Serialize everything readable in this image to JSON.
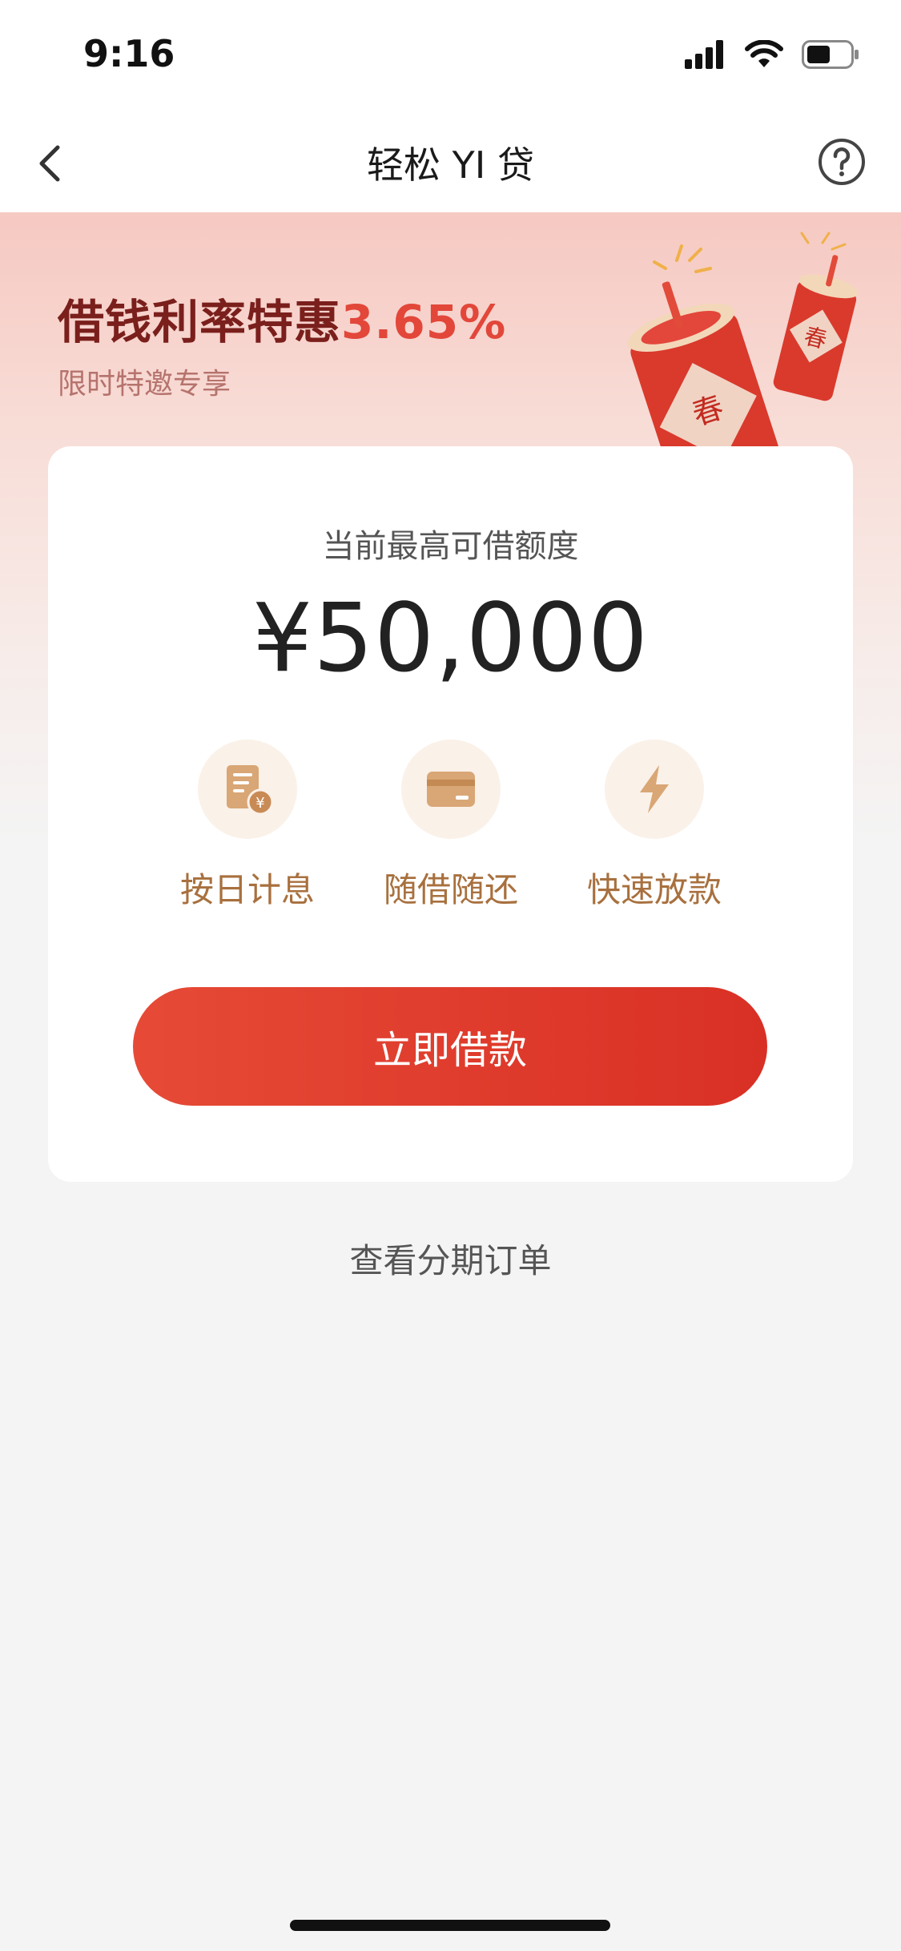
{
  "status_bar": {
    "time": "9:16",
    "battery_level": 0.55
  },
  "nav": {
    "title": "轻松 YI 贷",
    "back_icon": "chevron-left-icon",
    "help_icon": "question-circle-icon"
  },
  "promo": {
    "title_text": "借钱利率特惠",
    "rate": "3.65%",
    "subtitle": "限时特邀专享",
    "decoration_text": "春"
  },
  "card": {
    "limit_label": "当前最高可借额度",
    "limit_amount": "¥50,000",
    "features": [
      {
        "label": "按日计息",
        "icon": "receipt-yen-icon"
      },
      {
        "label": "随借随还",
        "icon": "card-icon"
      },
      {
        "label": "快速放款",
        "icon": "lightning-icon"
      }
    ],
    "borrow_button": "立即借款"
  },
  "orders_link": "查看分期订单",
  "colors": {
    "accent": "#e23b2e",
    "dark_red": "#7a1f1c",
    "gold": "#a8703e",
    "feature_bg": "#faf1e9"
  }
}
